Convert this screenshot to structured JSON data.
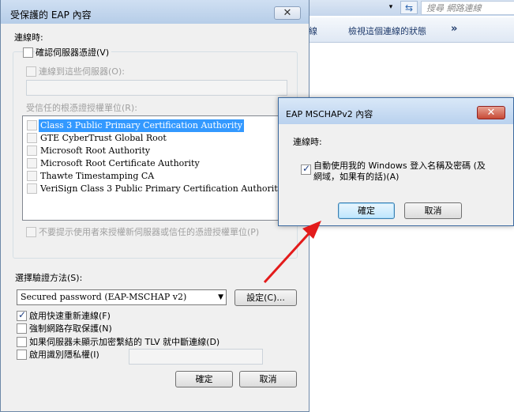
{
  "background_window": {
    "search_placeholder": "搜尋 網路連線",
    "refresh_glyph": "⇆",
    "dropdown_glyph": "▾",
    "commands": [
      "線",
      "檢視這個連線的狀態",
      "»"
    ]
  },
  "main_dialog": {
    "title": "受保護的 EAP 內容",
    "close_glyph": "✕",
    "connect_label": "連線時:",
    "verify_server": {
      "label": "確認伺服器憑證(V)",
      "checked": false
    },
    "connect_servers": {
      "label": "連線到這些伺服器(O):",
      "checked": false,
      "value": ""
    },
    "trusted_ca_label": "受信任的根憑證授權單位(R):",
    "ca_list": [
      {
        "label": "Class 3 Public Primary Certification Authority",
        "checked": false,
        "selected": true
      },
      {
        "label": "GTE CyberTrust Global Root",
        "checked": false,
        "selected": false
      },
      {
        "label": "Microsoft Root Authority",
        "checked": false,
        "selected": false
      },
      {
        "label": "Microsoft Root Certificate Authority",
        "checked": false,
        "selected": false
      },
      {
        "label": "Thawte Timestamping CA",
        "checked": false,
        "selected": false
      },
      {
        "label": "VeriSign Class 3 Public Primary Certification Authority - G5",
        "checked": false,
        "selected": false
      }
    ],
    "no_prompt": {
      "label": "不要提示使用者來授權新伺服器或信任的憑證授權單位(P)",
      "checked": false
    },
    "auth_method_label": "選擇驗證方法(S):",
    "auth_method_value": "Secured password (EAP-MSCHAP v2)",
    "configure_button": "設定(C)...",
    "options": [
      {
        "label": "啟用快速重新連線(F)",
        "checked": true
      },
      {
        "label": "強制網路存取保護(N)",
        "checked": false
      },
      {
        "label": "如果伺服器未顯示加密繫結的 TLV 就中斷連線(D)",
        "checked": false
      },
      {
        "label": "啟用識別隱私權(I)",
        "checked": false
      }
    ],
    "identity_privacy_value": "",
    "ok_button": "確定",
    "cancel_button": "取消"
  },
  "popup_dialog": {
    "title": "EAP MSCHAPv2 內容",
    "close_glyph": "✕",
    "connect_label": "連線時:",
    "auto_use_line1": "自動使用我的 Windows 登入名稱及密碼 (及",
    "auto_use_line2": "網域，如果有的話)(A)",
    "auto_use_checked": true,
    "ok_button": "確定",
    "cancel_button": "取消"
  },
  "annotation": {
    "arrow_color": "#e31b1b"
  }
}
